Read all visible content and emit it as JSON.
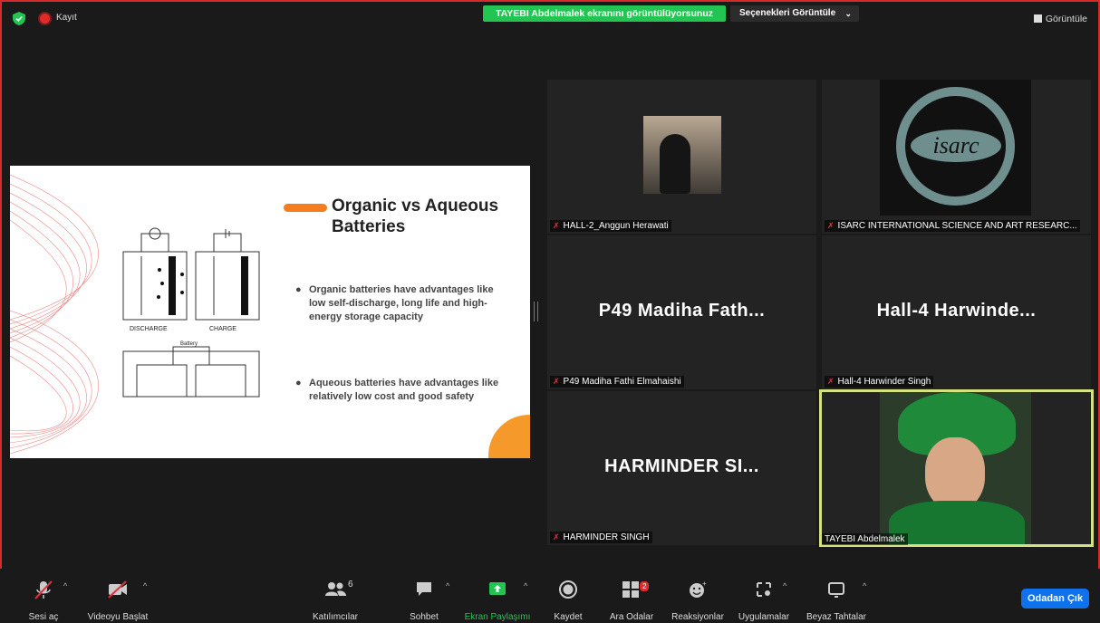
{
  "top": {
    "recording_label": "Kayıt",
    "share_banner": "TAYEBI Abdelmalek ekranını görüntülüyorsunuz",
    "view_options": "Seçenekleri Görüntüle",
    "view_button": "Görüntüle"
  },
  "slide": {
    "title": "Organic vs Aqueous Batteries",
    "bullets": [
      "Organic batteries have advantages like low self-discharge, long life and high-energy storage capacity",
      "Aqueous batteries have advantages like relatively low cost and good safety"
    ],
    "diagram_labels": {
      "discharge": "DISCHARGE",
      "charge": "CHARGE",
      "battery": "Battery"
    }
  },
  "participants": [
    {
      "name": "HALL-2_Anggun Herawati",
      "big": ""
    },
    {
      "name": "ISARC INTERNATIONAL SCIENCE AND ART RESEARC...",
      "big": ""
    },
    {
      "name": "P49 Madiha Fathi Elmahaishi",
      "big": "P49 Madiha Fath..."
    },
    {
      "name": "Hall-4 Harwinder Singh",
      "big": "Hall-4 Harwinde..."
    },
    {
      "name": "HARMINDER SINGH",
      "big": "HARMINDER SI..."
    },
    {
      "name": "TAYEBI Abdelmalek",
      "big": ""
    }
  ],
  "isarc_logo_text": "isarc",
  "toolbar": {
    "audio": "Sesi aç",
    "video": "Videoyu Başlat",
    "participants": "Katılımcılar",
    "participants_count": "6",
    "chat": "Sohbet",
    "share": "Ekran Paylaşımı",
    "record": "Kaydet",
    "breakout": "Ara Odalar",
    "breakout_badge": "2",
    "reactions": "Reaksiyonlar",
    "apps": "Uygulamalar",
    "whiteboard": "Beyaz Tahtalar",
    "leave": "Odadan Çık"
  },
  "colors": {
    "accent_green": "#23c552",
    "leave_blue": "#0e72ed",
    "mute_red": "#e0313a",
    "active_border": "#d6e282",
    "slide_orange": "#f47d20"
  }
}
